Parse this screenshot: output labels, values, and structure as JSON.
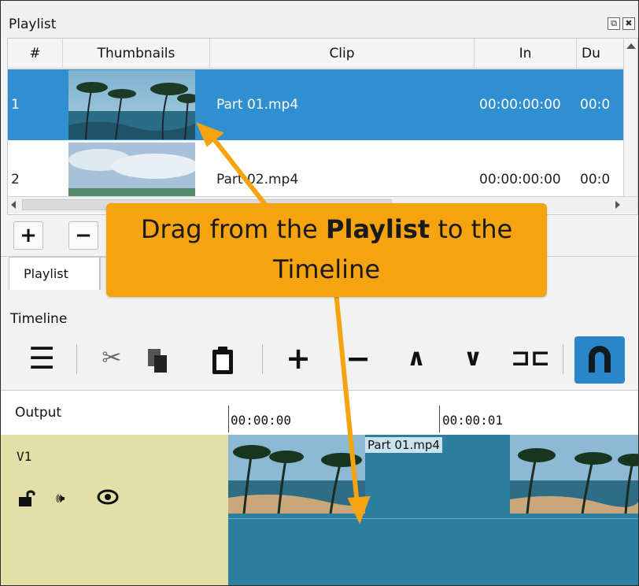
{
  "playlist": {
    "title": "Playlist",
    "columns": [
      "#",
      "Thumbnails",
      "Clip",
      "In",
      "Du"
    ],
    "rows": [
      {
        "num": "1",
        "clip": "Part 01.mp4",
        "in": "00:00:00:00",
        "du": "00:0"
      },
      {
        "num": "2",
        "clip": "Part 02.mp4",
        "in": "00:00:00:00",
        "du": "00:0"
      }
    ],
    "add_label": "+",
    "remove_label": "−",
    "tab_label": "Playlist"
  },
  "timeline": {
    "title": "Timeline",
    "output_label": "Output",
    "ruler": [
      "00:00:00",
      "00:00:01"
    ],
    "track_name": "V1",
    "clip_name": "Part 01.mp4"
  },
  "callout": {
    "prefix": "Drag from the ",
    "bold": "Playlist",
    "suffix": " to the",
    "line2": "Timeline"
  },
  "colors": {
    "selection": "#2f8fd0",
    "callout": "#f5a30f",
    "track": "#2c7f9f",
    "track_head": "#e2e0a6",
    "snap": "#2b86c9"
  }
}
